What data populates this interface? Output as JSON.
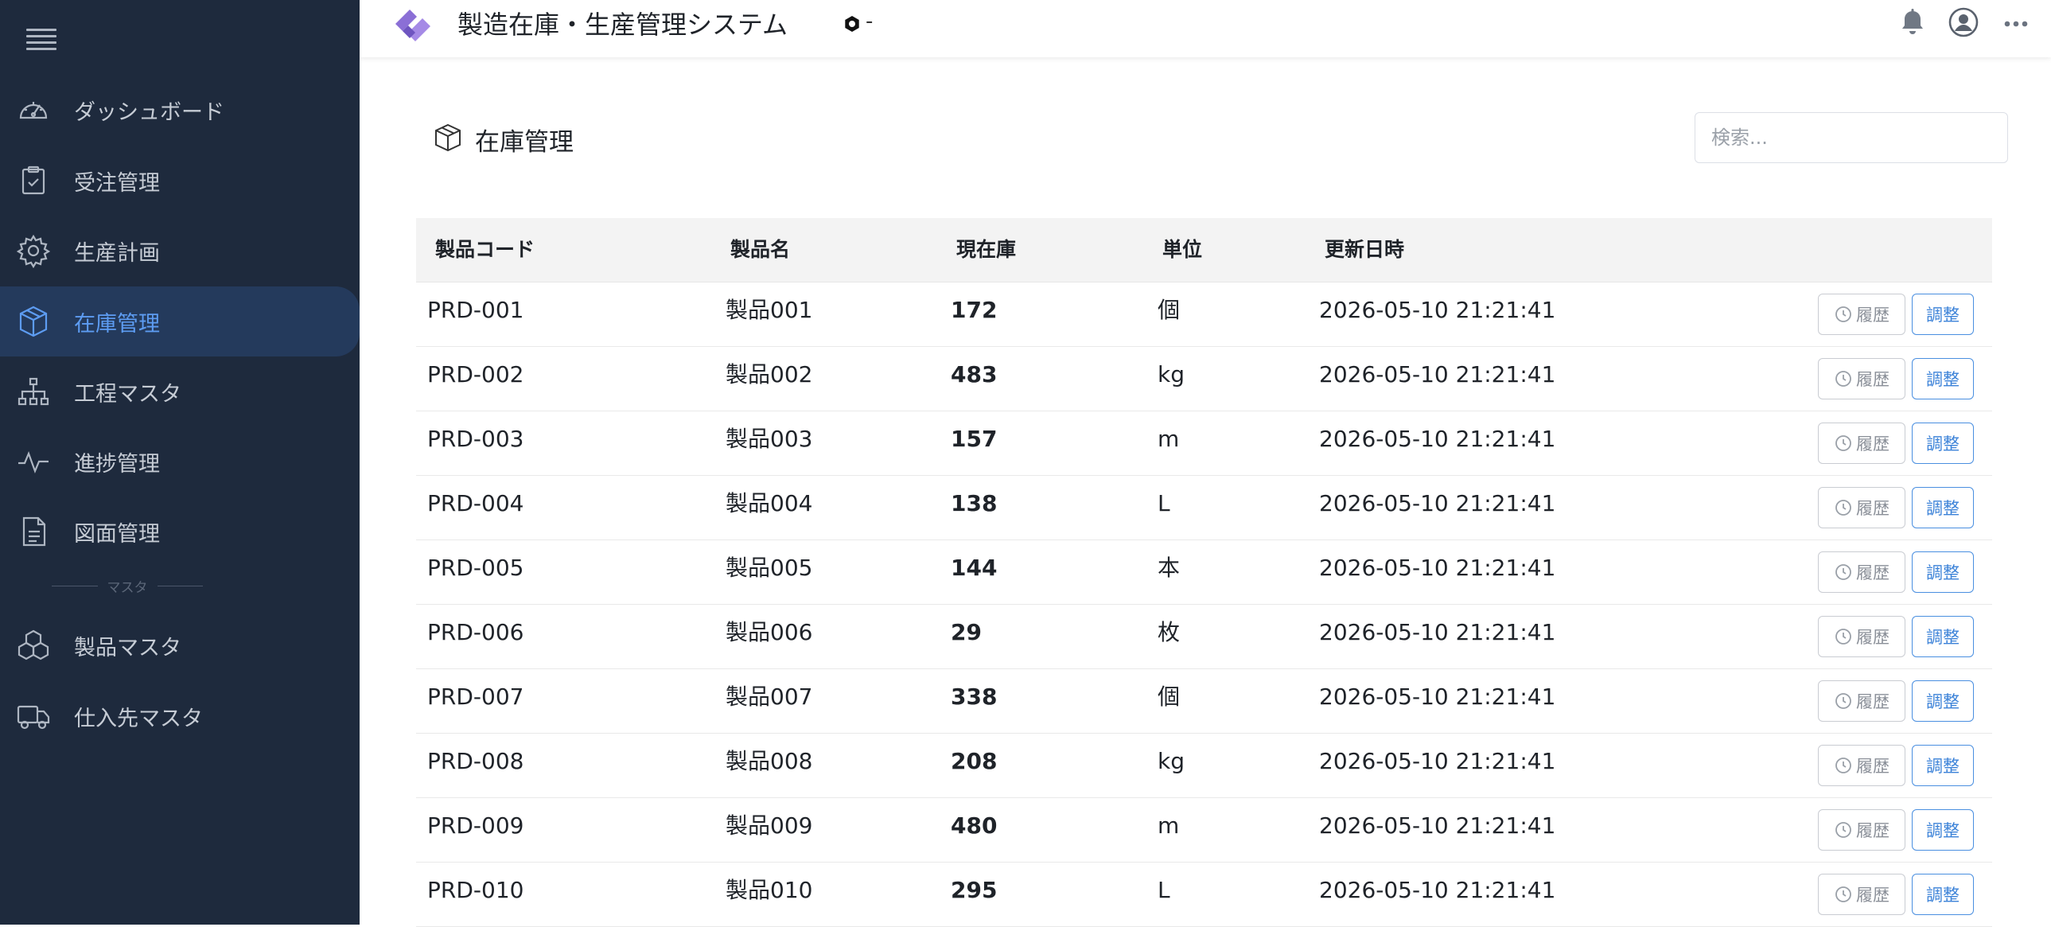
{
  "app": {
    "title": "製造在庫・生産管理システム",
    "status_text": "-"
  },
  "sidebar": {
    "items": [
      {
        "label": "ダッシュボード",
        "icon": "dashboard-gauge-icon"
      },
      {
        "label": "受注管理",
        "icon": "clipboard-check-icon"
      },
      {
        "label": "生産計画",
        "icon": "gear-icon"
      },
      {
        "label": "在庫管理",
        "icon": "box-icon",
        "active": true
      },
      {
        "label": "工程マスタ",
        "icon": "hierarchy-icon"
      },
      {
        "label": "進捗管理",
        "icon": "pulse-icon"
      },
      {
        "label": "図面管理",
        "icon": "document-icon"
      }
    ],
    "divider_label": "マスタ",
    "master_items": [
      {
        "label": "製品マスタ",
        "icon": "boxes-icon"
      },
      {
        "label": "仕入先マスタ",
        "icon": "truck-icon"
      }
    ]
  },
  "main": {
    "title": "在庫管理",
    "search_placeholder": "検索...",
    "table": {
      "headers": [
        "製品コード",
        "製品名",
        "現在庫",
        "単位",
        "更新日時"
      ],
      "rows": [
        {
          "code": "PRD-001",
          "name": "製品001",
          "qty": "172",
          "unit": "個",
          "updated": "2026-05-10 21:21:41"
        },
        {
          "code": "PRD-002",
          "name": "製品002",
          "qty": "483",
          "unit": "kg",
          "updated": "2026-05-10 21:21:41"
        },
        {
          "code": "PRD-003",
          "name": "製品003",
          "qty": "157",
          "unit": "m",
          "updated": "2026-05-10 21:21:41"
        },
        {
          "code": "PRD-004",
          "name": "製品004",
          "qty": "138",
          "unit": "L",
          "updated": "2026-05-10 21:21:41"
        },
        {
          "code": "PRD-005",
          "name": "製品005",
          "qty": "144",
          "unit": "本",
          "updated": "2026-05-10 21:21:41"
        },
        {
          "code": "PRD-006",
          "name": "製品006",
          "qty": "29",
          "unit": "枚",
          "updated": "2026-05-10 21:21:41"
        },
        {
          "code": "PRD-007",
          "name": "製品007",
          "qty": "338",
          "unit": "個",
          "updated": "2026-05-10 21:21:41"
        },
        {
          "code": "PRD-008",
          "name": "製品008",
          "qty": "208",
          "unit": "kg",
          "updated": "2026-05-10 21:21:41"
        },
        {
          "code": "PRD-009",
          "name": "製品009",
          "qty": "480",
          "unit": "m",
          "updated": "2026-05-10 21:21:41"
        },
        {
          "code": "PRD-010",
          "name": "製品010",
          "qty": "295",
          "unit": "L",
          "updated": "2026-05-10 21:21:41"
        }
      ],
      "history_label": "履歴",
      "adjust_label": "調整"
    }
  },
  "colors": {
    "sidebar_bg": "#1e2a3d",
    "active_bg": "#243a5c",
    "accent": "#5d9cf2",
    "logo": "#8b6fd6"
  }
}
